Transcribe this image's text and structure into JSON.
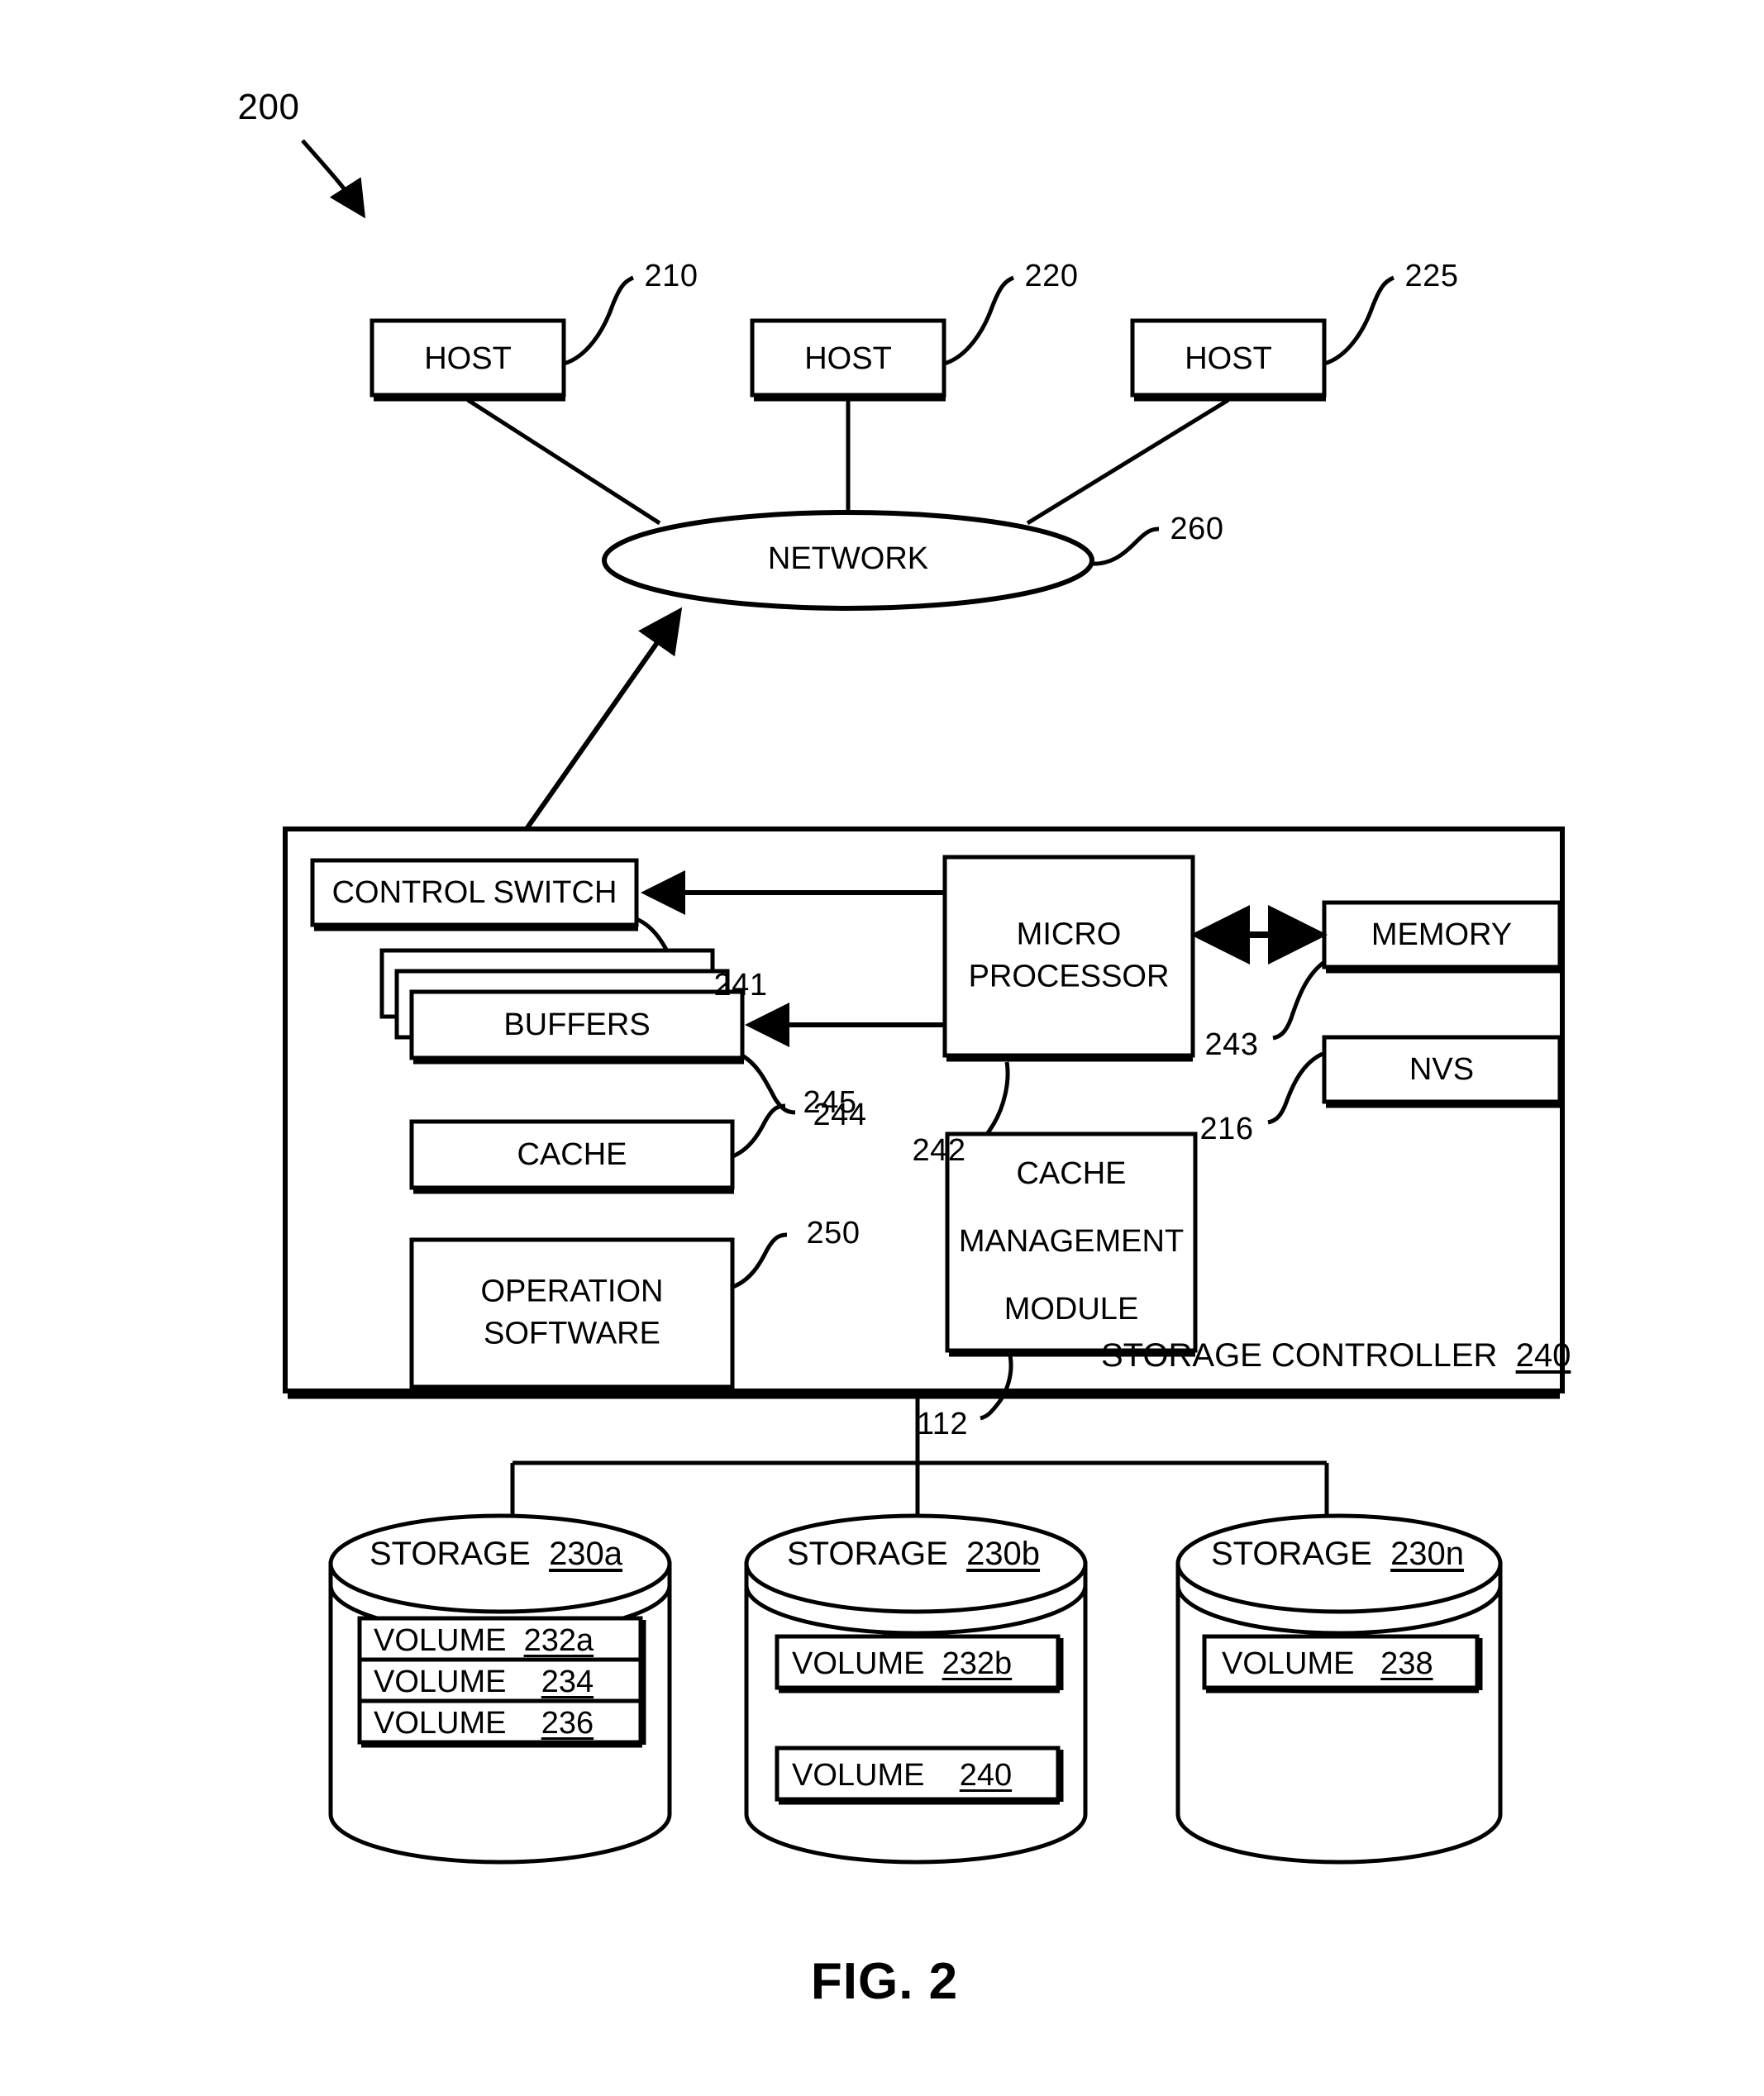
{
  "figure": {
    "caption": "FIG. 2",
    "system_ref": "200"
  },
  "hosts": [
    {
      "label": "HOST",
      "ref": "210"
    },
    {
      "label": "HOST",
      "ref": "220"
    },
    {
      "label": "HOST",
      "ref": "225"
    }
  ],
  "network": {
    "label": "NETWORK",
    "ref": "260"
  },
  "storage_controller": {
    "label": "STORAGE CONTROLLER",
    "ref": "240",
    "blocks": [
      {
        "name": "control-switch",
        "label": "CONTROL SWITCH",
        "ref": "241"
      },
      {
        "name": "buffers",
        "label": "BUFFERS",
        "ref": "244"
      },
      {
        "name": "cache",
        "label": "CACHE",
        "ref": "245"
      },
      {
        "name": "operation-software",
        "label_line1": "OPERATION",
        "label_line2": "SOFTWARE",
        "ref": "250"
      },
      {
        "name": "microprocessor",
        "label_line1": "MICRO",
        "label_line2": "PROCESSOR",
        "ref": "242"
      },
      {
        "name": "memory",
        "label": "MEMORY",
        "ref": "243"
      },
      {
        "name": "nvs",
        "label": "NVS",
        "ref": "216"
      },
      {
        "name": "cache-management-module",
        "label_line1": "CACHE",
        "label_line2": "MANAGEMENT",
        "label_line3": "MODULE",
        "ref": "112"
      }
    ]
  },
  "storages": [
    {
      "title": "STORAGE",
      "ref": "230a",
      "volumes": [
        {
          "label": "VOLUME",
          "ref": "232a"
        },
        {
          "label": "VOLUME",
          "ref": "234"
        },
        {
          "label": "VOLUME",
          "ref": "236"
        }
      ]
    },
    {
      "title": "STORAGE",
      "ref": "230b",
      "volumes": [
        {
          "label": "VOLUME",
          "ref": "232b"
        },
        {
          "label": "VOLUME",
          "ref": "240"
        }
      ]
    },
    {
      "title": "STORAGE",
      "ref": "230n",
      "volumes": [
        {
          "label": "VOLUME",
          "ref": "238"
        }
      ]
    }
  ],
  "colors": {
    "stroke": "#000000",
    "fill": "#ffffff"
  }
}
